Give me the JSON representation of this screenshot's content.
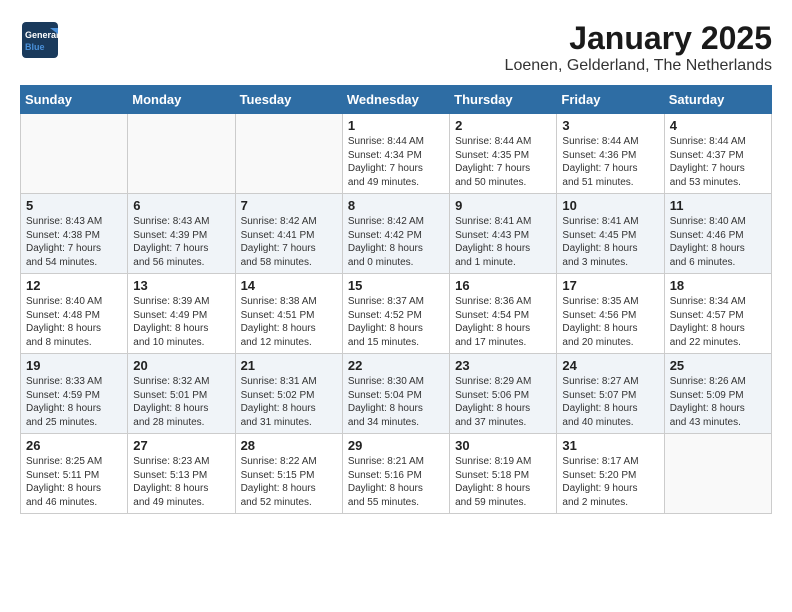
{
  "logo": {
    "line1": "General",
    "line2": "Blue"
  },
  "title": "January 2025",
  "location": "Loenen, Gelderland, The Netherlands",
  "weekdays": [
    "Sunday",
    "Monday",
    "Tuesday",
    "Wednesday",
    "Thursday",
    "Friday",
    "Saturday"
  ],
  "weeks": [
    [
      {
        "day": "",
        "content": ""
      },
      {
        "day": "",
        "content": ""
      },
      {
        "day": "",
        "content": ""
      },
      {
        "day": "1",
        "content": "Sunrise: 8:44 AM\nSunset: 4:34 PM\nDaylight: 7 hours\nand 49 minutes."
      },
      {
        "day": "2",
        "content": "Sunrise: 8:44 AM\nSunset: 4:35 PM\nDaylight: 7 hours\nand 50 minutes."
      },
      {
        "day": "3",
        "content": "Sunrise: 8:44 AM\nSunset: 4:36 PM\nDaylight: 7 hours\nand 51 minutes."
      },
      {
        "day": "4",
        "content": "Sunrise: 8:44 AM\nSunset: 4:37 PM\nDaylight: 7 hours\nand 53 minutes."
      }
    ],
    [
      {
        "day": "5",
        "content": "Sunrise: 8:43 AM\nSunset: 4:38 PM\nDaylight: 7 hours\nand 54 minutes."
      },
      {
        "day": "6",
        "content": "Sunrise: 8:43 AM\nSunset: 4:39 PM\nDaylight: 7 hours\nand 56 minutes."
      },
      {
        "day": "7",
        "content": "Sunrise: 8:42 AM\nSunset: 4:41 PM\nDaylight: 7 hours\nand 58 minutes."
      },
      {
        "day": "8",
        "content": "Sunrise: 8:42 AM\nSunset: 4:42 PM\nDaylight: 8 hours\nand 0 minutes."
      },
      {
        "day": "9",
        "content": "Sunrise: 8:41 AM\nSunset: 4:43 PM\nDaylight: 8 hours\nand 1 minute."
      },
      {
        "day": "10",
        "content": "Sunrise: 8:41 AM\nSunset: 4:45 PM\nDaylight: 8 hours\nand 3 minutes."
      },
      {
        "day": "11",
        "content": "Sunrise: 8:40 AM\nSunset: 4:46 PM\nDaylight: 8 hours\nand 6 minutes."
      }
    ],
    [
      {
        "day": "12",
        "content": "Sunrise: 8:40 AM\nSunset: 4:48 PM\nDaylight: 8 hours\nand 8 minutes."
      },
      {
        "day": "13",
        "content": "Sunrise: 8:39 AM\nSunset: 4:49 PM\nDaylight: 8 hours\nand 10 minutes."
      },
      {
        "day": "14",
        "content": "Sunrise: 8:38 AM\nSunset: 4:51 PM\nDaylight: 8 hours\nand 12 minutes."
      },
      {
        "day": "15",
        "content": "Sunrise: 8:37 AM\nSunset: 4:52 PM\nDaylight: 8 hours\nand 15 minutes."
      },
      {
        "day": "16",
        "content": "Sunrise: 8:36 AM\nSunset: 4:54 PM\nDaylight: 8 hours\nand 17 minutes."
      },
      {
        "day": "17",
        "content": "Sunrise: 8:35 AM\nSunset: 4:56 PM\nDaylight: 8 hours\nand 20 minutes."
      },
      {
        "day": "18",
        "content": "Sunrise: 8:34 AM\nSunset: 4:57 PM\nDaylight: 8 hours\nand 22 minutes."
      }
    ],
    [
      {
        "day": "19",
        "content": "Sunrise: 8:33 AM\nSunset: 4:59 PM\nDaylight: 8 hours\nand 25 minutes."
      },
      {
        "day": "20",
        "content": "Sunrise: 8:32 AM\nSunset: 5:01 PM\nDaylight: 8 hours\nand 28 minutes."
      },
      {
        "day": "21",
        "content": "Sunrise: 8:31 AM\nSunset: 5:02 PM\nDaylight: 8 hours\nand 31 minutes."
      },
      {
        "day": "22",
        "content": "Sunrise: 8:30 AM\nSunset: 5:04 PM\nDaylight: 8 hours\nand 34 minutes."
      },
      {
        "day": "23",
        "content": "Sunrise: 8:29 AM\nSunset: 5:06 PM\nDaylight: 8 hours\nand 37 minutes."
      },
      {
        "day": "24",
        "content": "Sunrise: 8:27 AM\nSunset: 5:07 PM\nDaylight: 8 hours\nand 40 minutes."
      },
      {
        "day": "25",
        "content": "Sunrise: 8:26 AM\nSunset: 5:09 PM\nDaylight: 8 hours\nand 43 minutes."
      }
    ],
    [
      {
        "day": "26",
        "content": "Sunrise: 8:25 AM\nSunset: 5:11 PM\nDaylight: 8 hours\nand 46 minutes."
      },
      {
        "day": "27",
        "content": "Sunrise: 8:23 AM\nSunset: 5:13 PM\nDaylight: 8 hours\nand 49 minutes."
      },
      {
        "day": "28",
        "content": "Sunrise: 8:22 AM\nSunset: 5:15 PM\nDaylight: 8 hours\nand 52 minutes."
      },
      {
        "day": "29",
        "content": "Sunrise: 8:21 AM\nSunset: 5:16 PM\nDaylight: 8 hours\nand 55 minutes."
      },
      {
        "day": "30",
        "content": "Sunrise: 8:19 AM\nSunset: 5:18 PM\nDaylight: 8 hours\nand 59 minutes."
      },
      {
        "day": "31",
        "content": "Sunrise: 8:17 AM\nSunset: 5:20 PM\nDaylight: 9 hours\nand 2 minutes."
      },
      {
        "day": "",
        "content": ""
      }
    ]
  ]
}
